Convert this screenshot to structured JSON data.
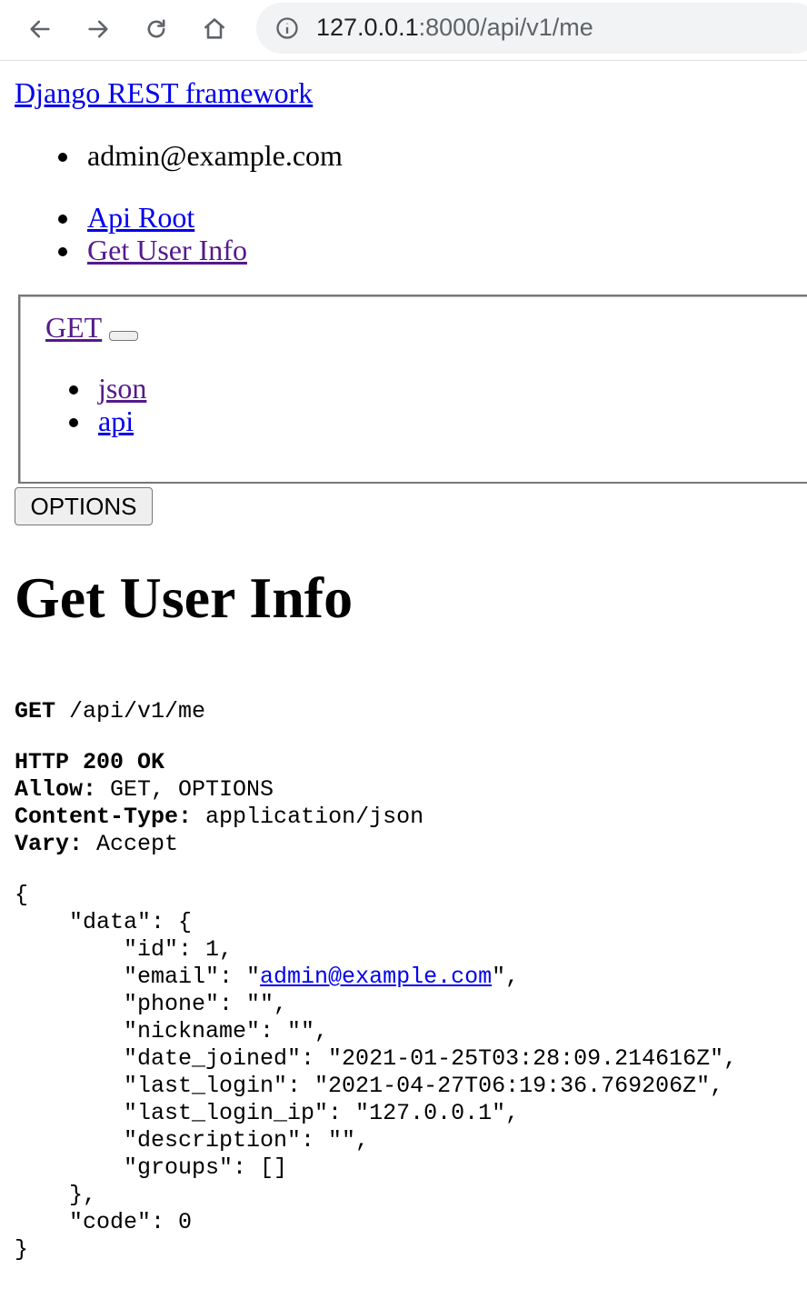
{
  "browser": {
    "url_host": "127.0.0.1",
    "url_rest": ":8000/api/v1/me"
  },
  "brand": "Django REST framework",
  "user": {
    "email": "admin@example.com"
  },
  "breadcrumbs": [
    "Api Root",
    "Get User Info"
  ],
  "format_box": {
    "get_label": "GET",
    "formats": [
      "json",
      "api"
    ]
  },
  "options_button": "OPTIONS",
  "page_title": "Get User Info",
  "request": {
    "method": "GET",
    "path": " /api/v1/me"
  },
  "response": {
    "status": "HTTP 200 OK",
    "headers": [
      {
        "name": "Allow:",
        "value": " GET, OPTIONS"
      },
      {
        "name": "Content-Type:",
        "value": " application/json"
      },
      {
        "name": "Vary:",
        "value": " Accept"
      }
    ],
    "body_open": "{",
    "data_open": "    \"data\": {",
    "id_line": "        \"id\": 1,",
    "email_prefix": "        \"email\": \"",
    "email_link": "admin@example.com",
    "email_suffix": "\",",
    "lines_after_email": [
      "        \"phone\": \"\",",
      "        \"nickname\": \"\",",
      "        \"date_joined\": \"2021-01-25T03:28:09.214616Z\",",
      "        \"last_login\": \"2021-04-27T06:19:36.769206Z\",",
      "        \"last_login_ip\": \"127.0.0.1\",",
      "        \"description\": \"\",",
      "        \"groups\": []",
      "    },",
      "    \"code\": 0",
      "}"
    ]
  }
}
